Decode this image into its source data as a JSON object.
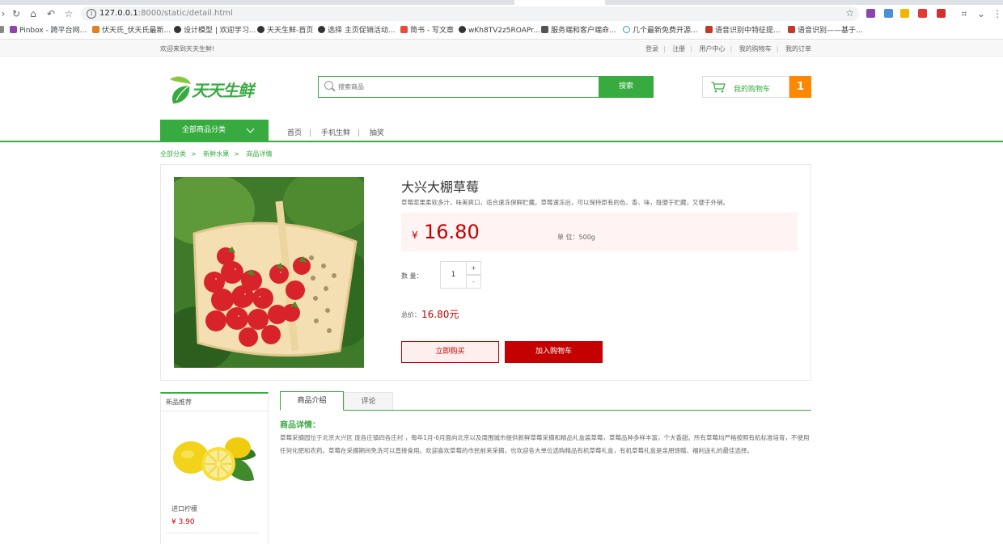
{
  "browser": {
    "url_host": "127.0.0.1",
    "url_path": ":8000/static/detail.html",
    "bookmarks": [
      {
        "label": "Pinbox - 跨平台网...",
        "color": "#8e44ad"
      },
      {
        "label": "伏天氏_伏天氏最新...",
        "color": "#e67e22"
      },
      {
        "label": "设计模型 | 欢迎学习...",
        "color": "#333333"
      },
      {
        "label": "天天生鲜-首页",
        "color": "#333333"
      },
      {
        "label": "选择 主页促销活动...",
        "color": "#333333"
      },
      {
        "label": "简书 - 写文章",
        "color": "#e74c3c"
      },
      {
        "label": "wKh8TV2z5ROAPr...",
        "color": "#333333"
      },
      {
        "label": "服务端和客户端命...",
        "color": "#555555"
      },
      {
        "label": "几个最新免费开源...",
        "color": "#3498db"
      },
      {
        "label": "语音识别中特征提...",
        "color": "#c0392b"
      },
      {
        "label": "语音识别——基于...",
        "color": "#c0392b"
      }
    ]
  },
  "site": {
    "welcome": "欢迎来到天天生鲜!",
    "user_nav": [
      "登录",
      "注册",
      "用户中心",
      "我的购物车",
      "我的订单"
    ],
    "logo_text": "天天生鲜",
    "search_placeholder": "搜索商品",
    "search_button": "搜索",
    "cart_label": "我的购物车",
    "cart_count": "1",
    "all_categories": "全部商品分类",
    "main_nav": [
      "首页",
      "手机生鲜",
      "抽奖"
    ],
    "breadcrumb": [
      "全部分类",
      "新鲜水果",
      "商品详情"
    ],
    "accent_color": "#37ab40",
    "price_color": "#c40000"
  },
  "product": {
    "title": "大兴大棚草莓",
    "description": "草莓浆果柔软多汁，味美爽口，适合速冻保鲜贮藏。草莓速冻后，可以保持原有的色、香、味，既便于贮藏，又便于外销。",
    "currency": "¥",
    "price": "16.80",
    "unit_label": "单 位：500g",
    "qty_label": "数 量：",
    "qty_value": "1",
    "qty_plus": "+",
    "qty_minus": "-",
    "total_label": "总价：",
    "total_value": "16.80元",
    "buy_now": "立即购买",
    "add_to_cart": "加入购物车"
  },
  "recommend": {
    "title": "新品推荐",
    "items": [
      {
        "name": "进口柠檬",
        "price": "¥ 3.90"
      }
    ]
  },
  "tabs": [
    "商品介绍",
    "评论"
  ],
  "detail": {
    "heading": "商品详情：",
    "text": "草莓采摘园位于北京大兴区 庞各庄镇四各庄村 ，每年1月-6月面向北京以及周围城市提供新鲜草莓采摘和精品礼盒装草莓，草莓品种多样丰富，个大香甜。所有草莓均严格按照有机标准培育，不使用任何化肥和农药。草莓在采摘期间免洗可以直接食用。欢迎喜欢草莓的市民前来采摘，也欢迎各大单位选购精品有机草莓礼盒，有机草莓礼盒是亲朋馈赠、福利送礼的最佳选择。"
  }
}
